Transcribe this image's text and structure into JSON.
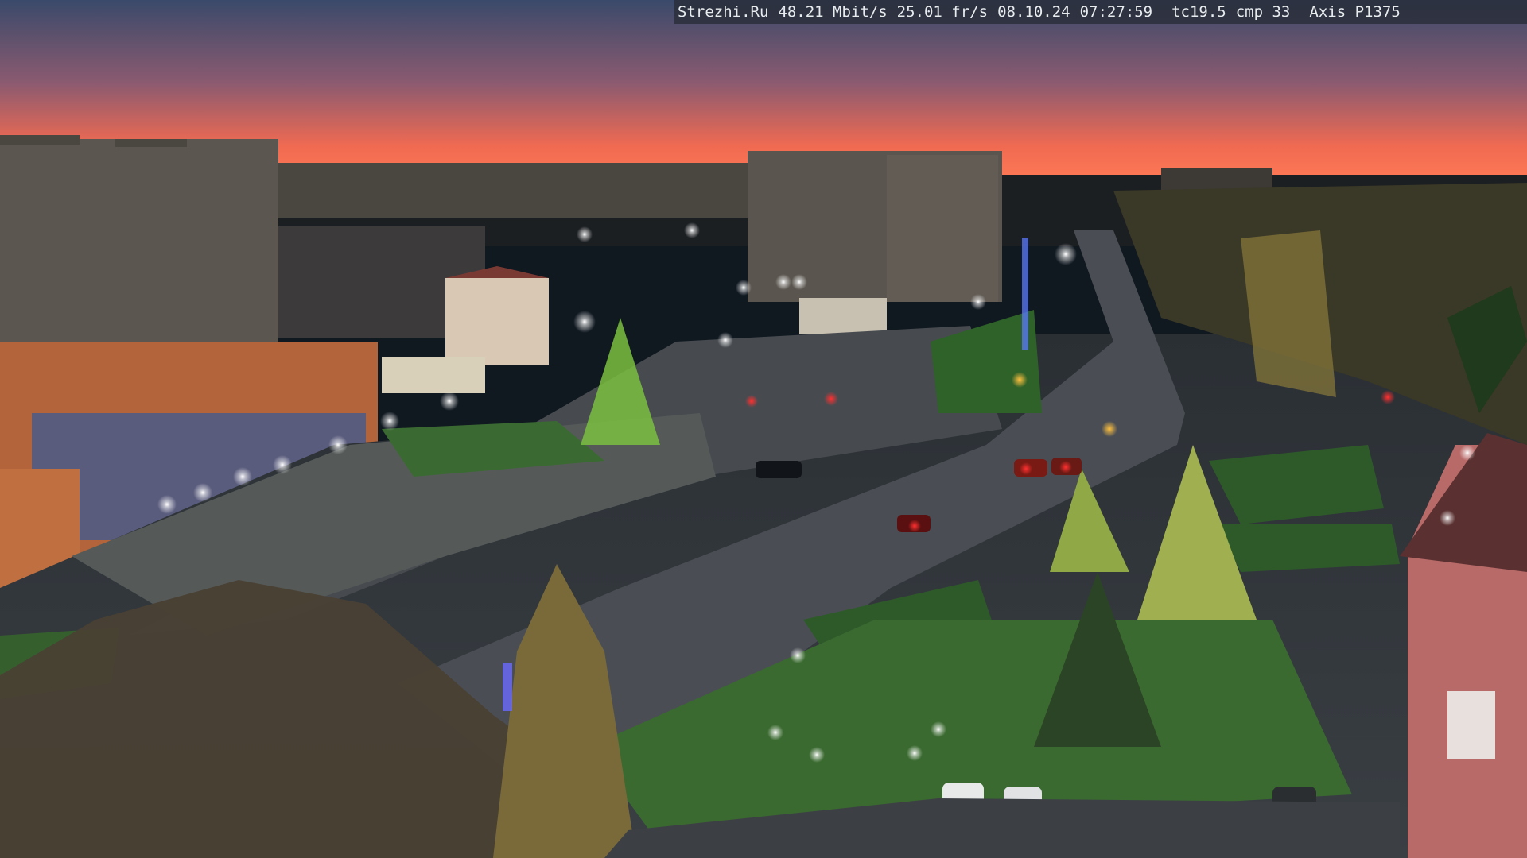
{
  "camera_overlay": {
    "site": "Strezhi.Ru",
    "bitrate": "48.21 Mbit/s",
    "framerate": "25.01 fr/s",
    "date": "08.10.24",
    "time": "07:27:59",
    "tc": "tc19.5",
    "cmp": "cmp 33",
    "camera_model": "Axis P1375"
  },
  "colors": {
    "sky_top": "#3b4b6b",
    "sky_glow": "#ff6a4a",
    "streetlight": "#ffffff",
    "traffic_red": "#ff2020",
    "traffic_amber": "#ffb020"
  }
}
